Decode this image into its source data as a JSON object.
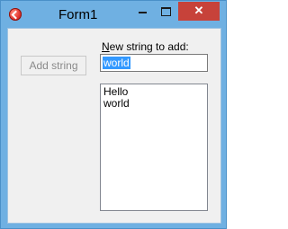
{
  "window": {
    "title": "Form1",
    "close_glyph": "✕",
    "icons": {
      "app": "app-icon",
      "minimize": "minimize-icon",
      "maximize": "maximize-icon",
      "close": "close-icon"
    }
  },
  "form": {
    "add_button_label": "Add string",
    "label_accel": "N",
    "label_rest": "ew string to add:",
    "input_value": "world",
    "list_items": [
      "Hello",
      "world"
    ]
  },
  "colors": {
    "titlebar": "#6fb0e2",
    "close_button": "#c7423a",
    "selection": "#3399ff",
    "client_background": "#f0f0f0"
  }
}
